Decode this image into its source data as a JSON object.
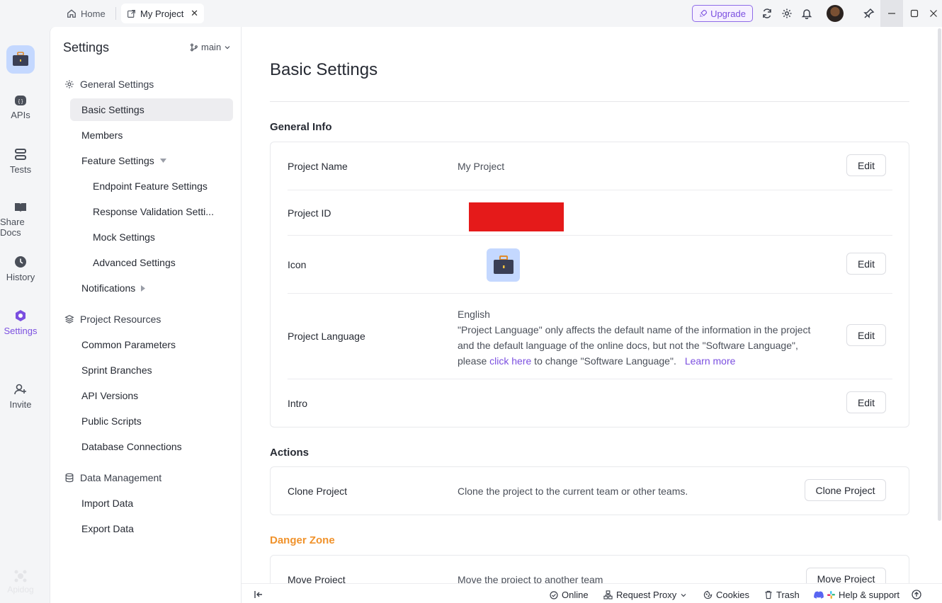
{
  "titlebar": {
    "home_tab": "Home",
    "project_tab": "My Project",
    "upgrade_label": "Upgrade"
  },
  "rail": {
    "items": [
      {
        "label": "APIs",
        "icon": "apis-icon"
      },
      {
        "label": "Tests",
        "icon": "tests-icon"
      },
      {
        "label": "Share Docs",
        "icon": "book-icon"
      },
      {
        "label": "History",
        "icon": "clock-icon"
      },
      {
        "label": "Settings",
        "icon": "gear-icon"
      },
      {
        "label": "Invite",
        "icon": "add-user-icon"
      }
    ],
    "brand": "Apidog"
  },
  "sidepanel": {
    "title": "Settings",
    "branch": "main",
    "groups": [
      {
        "label": "General Settings",
        "icon": "gear-icon"
      },
      {
        "label": "Project Resources",
        "icon": "layers-icon"
      },
      {
        "label": "Data Management",
        "icon": "database-icon"
      }
    ],
    "general_items": [
      "Basic Settings",
      "Members",
      "Feature Settings",
      "Endpoint Feature Settings",
      "Response Validation Setti...",
      "Mock Settings",
      "Advanced Settings",
      "Notifications"
    ],
    "resource_items": [
      "Common Parameters",
      "Sprint Branches",
      "API Versions",
      "Public Scripts",
      "Database Connections"
    ],
    "data_items": [
      "Import Data",
      "Export Data"
    ]
  },
  "main": {
    "page_title": "Basic Settings",
    "general_info": {
      "heading": "General Info",
      "project_name_label": "Project Name",
      "project_name_value": "My Project",
      "project_id_label": "Project ID",
      "icon_label": "Icon",
      "language_label": "Project Language",
      "language_value": "English",
      "language_desc_1": "\"Project Language\" only affects the default name of the information in the project and the default language of the online docs, but not the \"Software Language\", please ",
      "language_link": "click here",
      "language_desc_2": " to change \"Software Language\".",
      "learn_more": "Learn more",
      "intro_label": "Intro",
      "edit_label": "Edit"
    },
    "actions": {
      "heading": "Actions",
      "clone_label": "Clone Project",
      "clone_desc": "Clone the project to the current team or other teams.",
      "clone_button": "Clone Project"
    },
    "danger": {
      "heading": "Danger Zone",
      "move_label": "Move Project",
      "move_desc": "Move the project to another team",
      "move_button": "Move Project",
      "color": "#f0922b"
    }
  },
  "footer": {
    "online": "Online",
    "request_proxy": "Request Proxy",
    "cookies": "Cookies",
    "trash": "Trash",
    "help": "Help & support"
  },
  "colors": {
    "accent": "#7b4fe0",
    "redaction": "#e51a1a"
  }
}
